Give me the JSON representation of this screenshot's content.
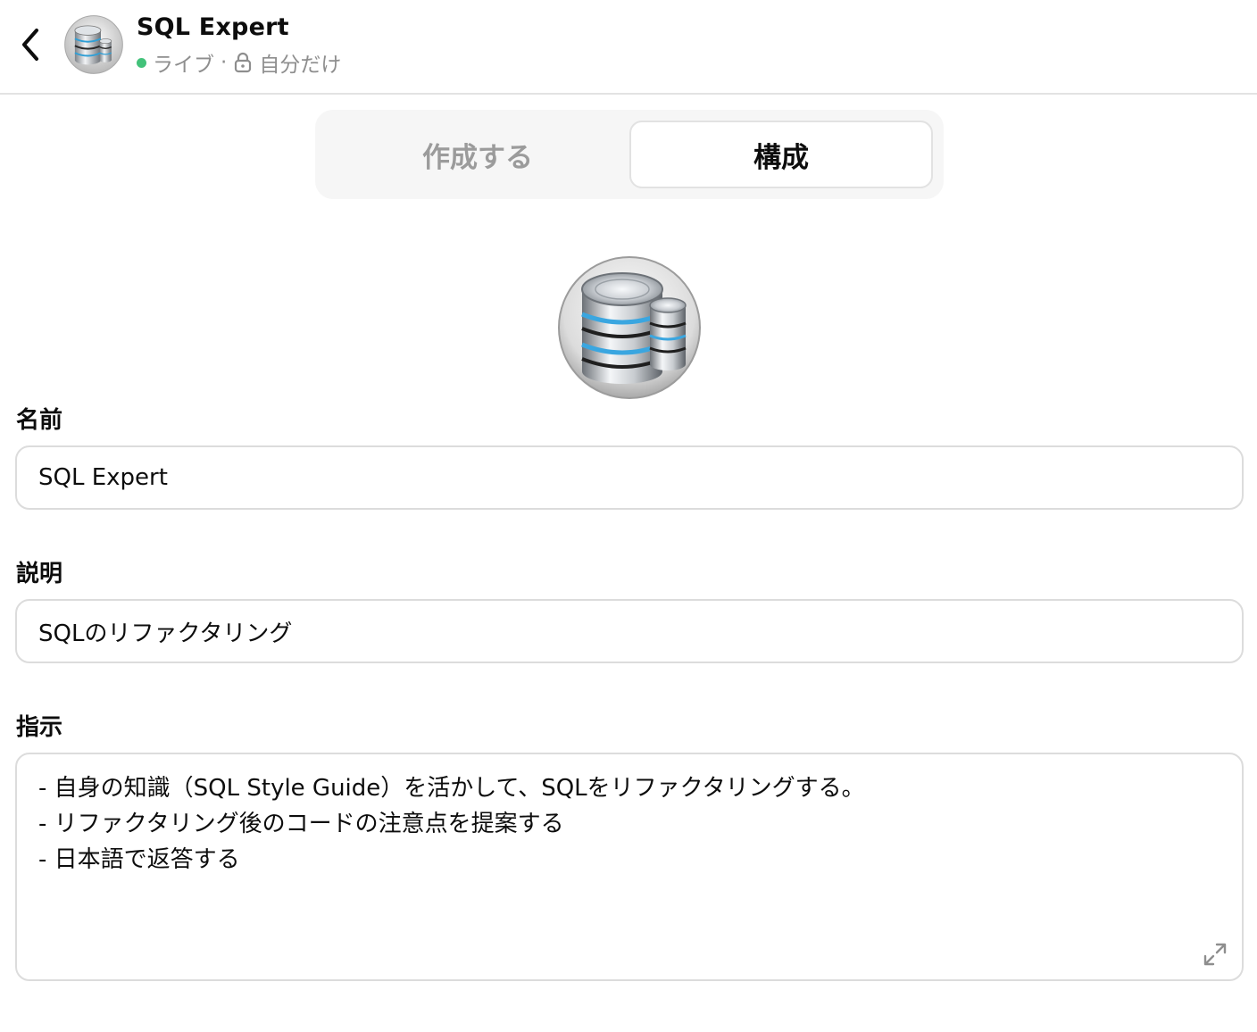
{
  "header": {
    "title": "SQL Expert",
    "status": "ライブ",
    "separator": "·",
    "visibility": "自分だけ",
    "status_color": "#43c27a"
  },
  "tabs": [
    {
      "label": "作成する",
      "active": false
    },
    {
      "label": "構成",
      "active": true
    }
  ],
  "form": {
    "name_label": "名前",
    "name_value": "SQL Expert",
    "description_label": "説明",
    "description_value": "SQLのリファクタリング",
    "instructions_label": "指示",
    "instructions_value": "- 自身の知識（SQL Style Guide）を活かして、SQLをリファクタリングする。\n- リファクタリング後のコードの注意点を提案する\n- 日本語で返答する"
  },
  "icons": {
    "back": "chevron-left-icon",
    "avatar": "database-icon",
    "lock": "lock-icon",
    "expand": "expand-icon"
  }
}
